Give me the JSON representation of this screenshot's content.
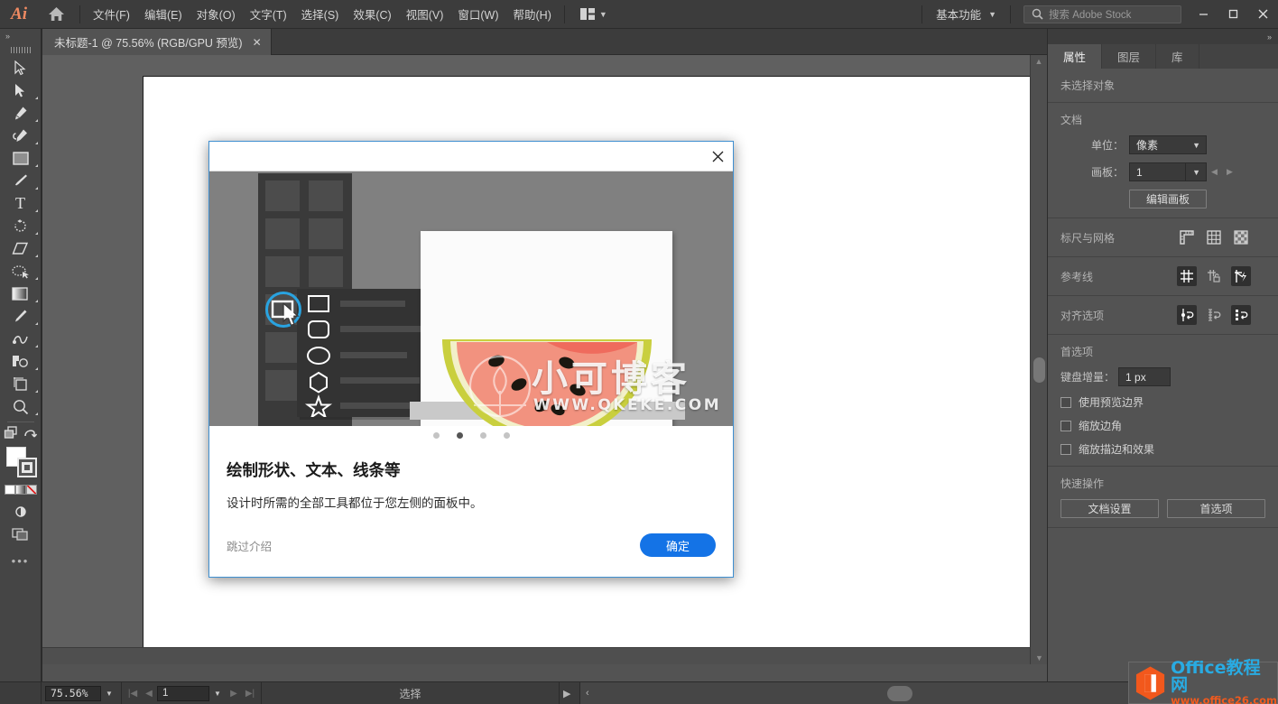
{
  "app": {
    "logo_text": "Ai",
    "home_icon": "home-icon"
  },
  "menubar": {
    "items": [
      {
        "label": "文件(F)"
      },
      {
        "label": "编辑(E)"
      },
      {
        "label": "对象(O)"
      },
      {
        "label": "文字(T)"
      },
      {
        "label": "选择(S)"
      },
      {
        "label": "效果(C)"
      },
      {
        "label": "视图(V)"
      },
      {
        "label": "窗口(W)"
      },
      {
        "label": "帮助(H)"
      }
    ],
    "arrange_icon": "arrange-documents-icon",
    "workspace": "基本功能",
    "search_placeholder": "搜索 Adobe Stock",
    "window_buttons": {
      "minimize": "−",
      "maximize": "☐",
      "close": "✕"
    }
  },
  "tabbar": {
    "document_title": "未标题-1 @ 75.56% (RGB/GPU 预览)",
    "close_label": "✕",
    "collapse_label": "»"
  },
  "toolbar": {
    "expand_label": "»",
    "tools": [
      {
        "name": "selection-tool"
      },
      {
        "name": "direct-selection-tool"
      },
      {
        "name": "pen-tool"
      },
      {
        "name": "curvature-tool"
      },
      {
        "name": "rectangle-tool"
      },
      {
        "name": "paintbrush-tool"
      },
      {
        "name": "type-tool"
      },
      {
        "name": "rotate-tool"
      },
      {
        "name": "eraser-tool"
      },
      {
        "name": "scale-tool"
      },
      {
        "name": "gradient-tool"
      },
      {
        "name": "eyedropper-tool"
      },
      {
        "name": "blend-tool"
      },
      {
        "name": "shaper-tool"
      },
      {
        "name": "artboard-tool"
      },
      {
        "name": "zoom-tool"
      }
    ]
  },
  "canvas": {
    "zoom_percent": "75.56%",
    "artboard_number": "1"
  },
  "statusbar": {
    "zoom_value": "75.56%",
    "page_value": "1",
    "tool_status": "选择",
    "nav_first": "|◀",
    "nav_prev": "◀",
    "nav_next": "▶",
    "nav_last": "▶|"
  },
  "properties_panel": {
    "collapse_label": "»",
    "tabs": [
      {
        "label": "属性",
        "active": true
      },
      {
        "label": "图层",
        "active": false
      },
      {
        "label": "库",
        "active": false
      }
    ],
    "no_selection": "未选择对象",
    "document": {
      "heading": "文档",
      "units_label": "单位：",
      "units_value": "像素",
      "artboard_label": "画板：",
      "artboard_value": "1",
      "edit_artboards_button": "编辑画板"
    },
    "rulers_grid": {
      "heading": "标尺与网格",
      "icons": [
        "show-rulers-icon",
        "show-grid-icon",
        "show-transparency-grid-icon"
      ]
    },
    "guides": {
      "heading": "参考线",
      "icons": [
        "show-guides-icon",
        "lock-guides-icon",
        "smart-guides-icon"
      ]
    },
    "snap_options": {
      "heading": "对齐选项",
      "icons": [
        "snap-to-point-icon",
        "snap-to-grid-icon",
        "snap-to-pixel-icon"
      ]
    },
    "preferences": {
      "heading": "首选项",
      "keyboard_increment_label": "键盘增量：",
      "keyboard_increment_value": "1 px",
      "checkboxes": [
        {
          "label": "使用预览边界",
          "checked": false
        },
        {
          "label": "缩放边角",
          "checked": false
        },
        {
          "label": "缩放描边和效果",
          "checked": false
        }
      ]
    },
    "quick_actions": {
      "heading": "快速操作",
      "buttons": [
        "文档设置",
        "首选项"
      ]
    }
  },
  "dialog": {
    "close_label": "✕",
    "pagination": {
      "count": 4,
      "active_index": 1
    },
    "heading": "绘制形状、文本、线条等",
    "body": "设计时所需的全部工具都位于您左侧的面板中。",
    "skip_label": "跳过介绍",
    "ok_label": "确定",
    "illustration": {
      "shape_items": [
        "rectangle-shape",
        "rounded-rectangle-shape",
        "ellipse-shape",
        "polygon-shape",
        "star-shape"
      ],
      "highlight_icon": "rectangle-tool-highlight",
      "cursor_icon": "mouse-cursor-icon",
      "artwork": "watermelon-slice-illustration"
    }
  },
  "watermarks": {
    "blog_name": "小可博客",
    "blog_url": "WWW.QKEKE.COM",
    "office_name": "Office教程网",
    "office_url": "www.office26.com"
  },
  "colors": {
    "accent_blue": "#1473e6",
    "highlight_blue": "#29a3e0",
    "panel_bg": "#535353",
    "menubar_bg": "#3c3c3c",
    "toolbar_bg": "#454545",
    "logo_orange": "#ef8a62"
  }
}
